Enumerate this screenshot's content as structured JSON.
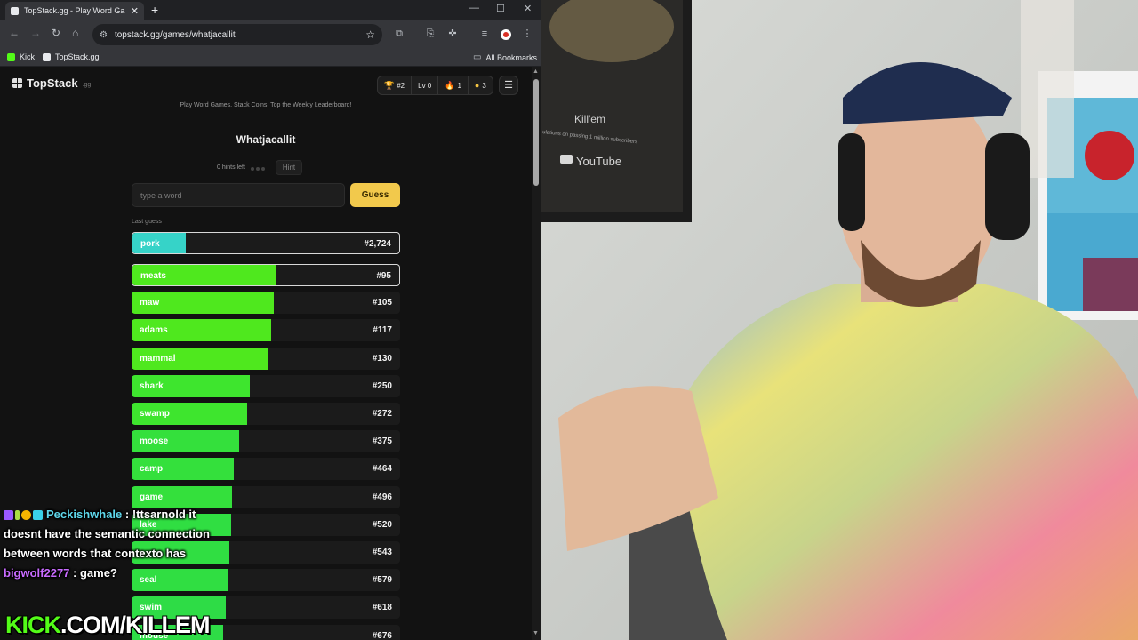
{
  "browser": {
    "tab_title": "TopStack.gg - Play Word Games",
    "url": "topstack.gg/games/whatjacallit",
    "bookmarks": [
      {
        "label": "Kick",
        "color": "#53fc18"
      },
      {
        "label": "TopStack.gg",
        "color": "#e8eaed"
      }
    ],
    "all_bookmarks": "All Bookmarks"
  },
  "site": {
    "logo": "TopStack",
    "logo_suffix": ".gg",
    "stats": [
      {
        "icon": "trophy-icon",
        "glyph": "🏆",
        "value": "#2"
      },
      {
        "icon": "level-icon",
        "glyph": "",
        "value": "Lv 0"
      },
      {
        "icon": "flame-icon",
        "glyph": "🔥",
        "value": "1"
      },
      {
        "icon": "coin-icon",
        "glyph": "●",
        "value": "3"
      }
    ],
    "tagline": "Play Word Games. Stack Coins. Top the Weekly Leaderboard!"
  },
  "game": {
    "title": "Whatjacallit",
    "hints_left": "0 hints left",
    "hint_button": "Hint",
    "input_placeholder": "type a word",
    "guess_button": "Guess",
    "last_guess_label": "Last guess",
    "last_guess": {
      "word": "pork",
      "rank": "#2,724",
      "fill": 0.2,
      "color": "#36d3c8"
    },
    "guesses": [
      {
        "word": "meats",
        "rank": "#95",
        "fill": 0.54,
        "color": "#4fe81e"
      },
      {
        "word": "maw",
        "rank": "#105",
        "fill": 0.53,
        "color": "#4fe81e"
      },
      {
        "word": "adams",
        "rank": "#117",
        "fill": 0.52,
        "color": "#4fe81e"
      },
      {
        "word": "mammal",
        "rank": "#130",
        "fill": 0.51,
        "color": "#4fe81e"
      },
      {
        "word": "shark",
        "rank": "#250",
        "fill": 0.44,
        "color": "#3ee52e"
      },
      {
        "word": "swamp",
        "rank": "#272",
        "fill": 0.43,
        "color": "#3ee52e"
      },
      {
        "word": "moose",
        "rank": "#375",
        "fill": 0.4,
        "color": "#34e03c"
      },
      {
        "word": "camp",
        "rank": "#464",
        "fill": 0.38,
        "color": "#34e03c"
      },
      {
        "word": "game",
        "rank": "#496",
        "fill": 0.375,
        "color": "#34e03c"
      },
      {
        "word": "lake",
        "rank": "#520",
        "fill": 0.37,
        "color": "#30de42"
      },
      {
        "word": "",
        "rank": "#543",
        "fill": 0.365,
        "color": "#30de42"
      },
      {
        "word": "seal",
        "rank": "#579",
        "fill": 0.36,
        "color": "#30de42"
      },
      {
        "word": "swim",
        "rank": "#618",
        "fill": 0.35,
        "color": "#2edc46"
      },
      {
        "word": "mouse",
        "rank": "#676",
        "fill": 0.34,
        "color": "#2edc46"
      }
    ]
  },
  "chat": {
    "messages": [
      {
        "user": "Peckishwhale",
        "text": "!ttsarnold it doesnt have the semantic connection between words that contexto has"
      },
      {
        "user": "bigwolf2277",
        "text": "game?"
      }
    ],
    "brand_prefix": "KICK",
    "brand_rest": ".COM/KILLEM"
  },
  "webcam": {
    "plaque_text": "Kill'em",
    "plaque_subtext": "ulations on passing 1 million subscribers",
    "plaque_brand": "YouTube"
  }
}
